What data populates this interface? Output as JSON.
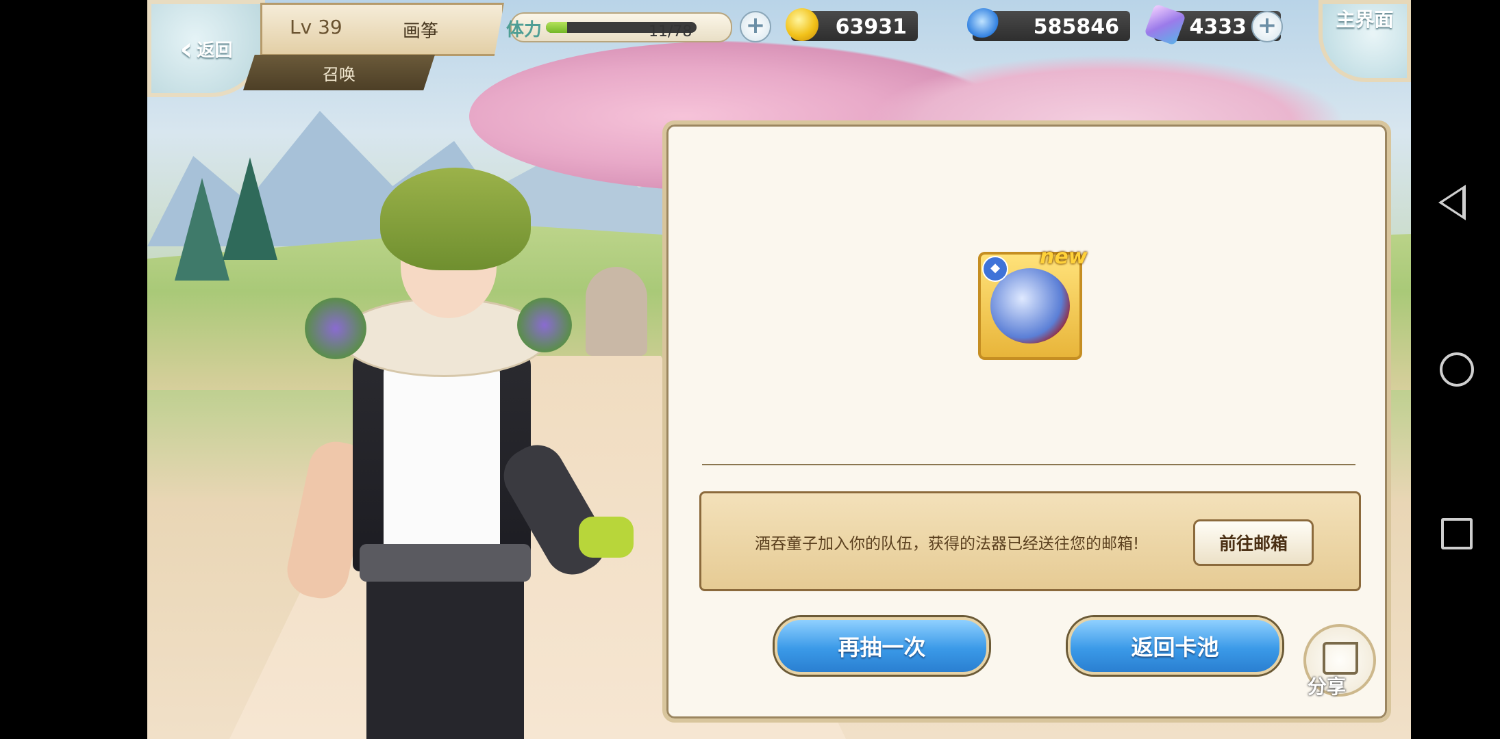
{
  "header": {
    "back_label": "返回",
    "level": "Lv 39",
    "player_name": "画筝",
    "page_title": "召唤",
    "home_label": "主界面"
  },
  "stamina": {
    "label": "体力",
    "value": "11/78",
    "fraction": 0.141
  },
  "currencies": {
    "gold": "63931",
    "soul": "585846",
    "crystal": "4333"
  },
  "result": {
    "new_badge": "new",
    "reward_element_icon": "water-element-icon",
    "notice_text": "酒吞童子加入你的队伍，获得的法器已经送往您的邮箱!",
    "mailbox_button": "前往邮箱",
    "draw_again": "再抽一次",
    "back_to_pool": "返回卡池",
    "share": "分享"
  },
  "colors": {
    "accent_blue": "#3b9ae8",
    "stamina_green": "#74b828",
    "gold_border": "#d8c59c"
  }
}
